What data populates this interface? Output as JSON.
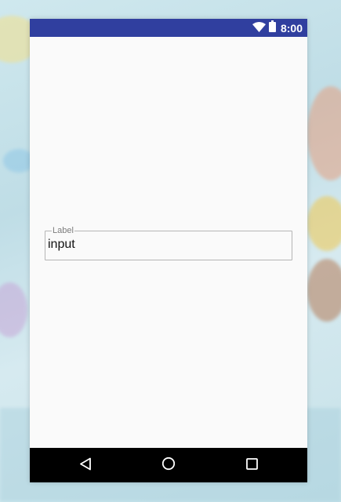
{
  "status_bar": {
    "time": "8:00",
    "icons": [
      "wifi-icon",
      "battery-icon"
    ],
    "color": "#303f9f"
  },
  "form": {
    "field": {
      "label": "Label",
      "value": "input"
    }
  },
  "nav_bar": {
    "buttons": [
      "back-icon",
      "home-icon",
      "recents-icon"
    ]
  }
}
